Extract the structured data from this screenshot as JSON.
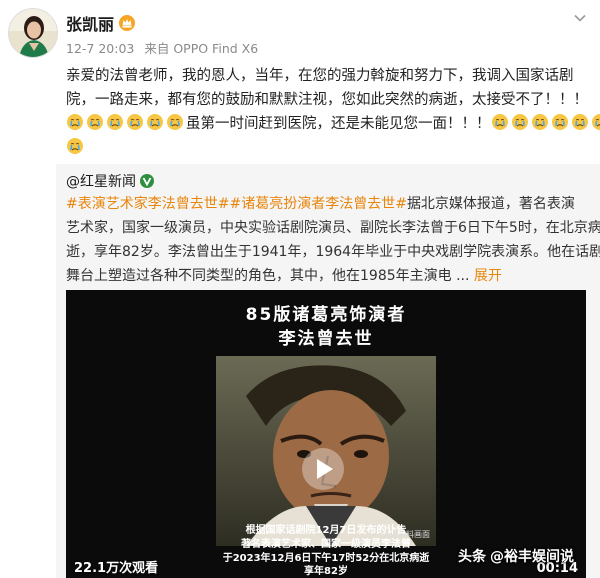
{
  "post": {
    "username": "张凯丽",
    "meta": {
      "time": "12-7 20:03",
      "source": "来自 OPPO Find X6"
    },
    "content_lines": [
      "亲爱的法曾老师，我的恩人，当年，在您的强力斡旋和努力下，我调入国家话剧",
      "院，一路走来，都有您的鼓励和默默注视，您如此突然的病逝，太接受不了！！！",
      "虽第一时间赶到医院，还是未能见您一面！！！"
    ],
    "icons": {
      "vip": "vip-crown-icon",
      "more": "chevron-down-icon",
      "cry": "crying-emoji-icon"
    }
  },
  "repost": {
    "user": "@红星新闻",
    "topic1": "#表演艺术家李法曾去世#",
    "topic2": "#诸葛亮扮演者李法曾去世#",
    "text_after_topics": "据北京媒体报道，著名表演",
    "lines": [
      "艺术家，国家一级演员，中央实验话剧院演员、副院长李法曾于6日下午5时，在北京病",
      "逝，享年82岁。李法曾出生于1941年，1964年毕业于中央戏剧学院表演系。他在话剧"
    ],
    "last_line": "舞台上塑造过各种不同类型的角色，其中，他在1985年主演电 ...",
    "expand_label": "展开",
    "accent_color": "#e8850b"
  },
  "video": {
    "title_line1": "85版诸葛亮饰演者",
    "title_line2": "李法曾去世",
    "still_caption": "影视资料画面",
    "subtitles": [
      "根据国家话剧院12月7日发布的讣告",
      "著名表演艺术家、国家一级演员李法曾",
      "于2023年12月6日下午17时52分在北京病逝",
      "享年82岁"
    ],
    "views": "22.1万次观看",
    "duration": "00:14"
  },
  "watermark": {
    "brand": "头条",
    "account": "@裕丰娱间说"
  }
}
